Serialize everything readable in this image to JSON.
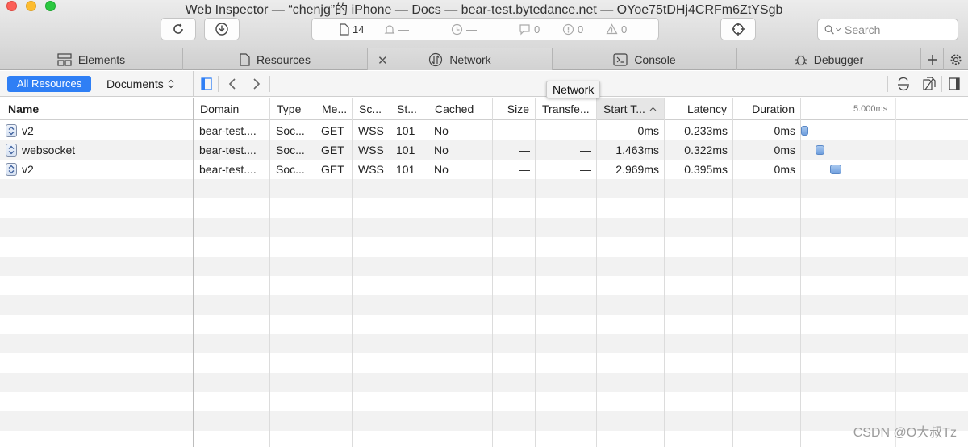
{
  "window": {
    "title": "Web Inspector — “chenjg”的 iPhone — Docs — bear-test.bytedance.net — OYoe75tDHj4CRFm6ZtYSgb"
  },
  "toolbar": {
    "resource_count": "14",
    "timeline_dash": "—",
    "timer_dash": "—",
    "log_count": "0",
    "error_count": "0",
    "warning_count": "0",
    "search_placeholder": "Search"
  },
  "tabs": [
    {
      "label": "Elements"
    },
    {
      "label": "Resources"
    },
    {
      "label": "Network"
    },
    {
      "label": "Console"
    },
    {
      "label": "Debugger"
    }
  ],
  "filters": {
    "all_resources": "All Resources",
    "documents": "Documents"
  },
  "tooltip": "Network",
  "left_pane": {
    "header": "Name"
  },
  "columns": {
    "domain": "Domain",
    "type": "Type",
    "method": "Me...",
    "scheme": "Sc...",
    "status": "St...",
    "cached": "Cached",
    "size": "Size",
    "transferred": "Transfe...",
    "start_time": "Start T...",
    "latency": "Latency",
    "duration": "Duration",
    "timeline_tick": "5.000ms"
  },
  "rows": [
    {
      "name": "v2",
      "domain": "bear-test....",
      "type": "Soc...",
      "method": "GET",
      "scheme": "WSS",
      "status": "101",
      "cached": "No",
      "size": "—",
      "transferred": "—",
      "start_time": "0ms",
      "latency": "0.233ms",
      "duration": "0ms",
      "start_ms": 0,
      "latency_ms": 0.233
    },
    {
      "name": "websocket",
      "domain": "bear-test....",
      "type": "Soc...",
      "method": "GET",
      "scheme": "WSS",
      "status": "101",
      "cached": "No",
      "size": "—",
      "transferred": "—",
      "start_time": "1.463ms",
      "latency": "0.322ms",
      "duration": "0ms",
      "start_ms": 1.463,
      "latency_ms": 0.322
    },
    {
      "name": "v2",
      "domain": "bear-test....",
      "type": "Soc...",
      "method": "GET",
      "scheme": "WSS",
      "status": "101",
      "cached": "No",
      "size": "—",
      "transferred": "—",
      "start_time": "2.969ms",
      "latency": "0.395ms",
      "duration": "0ms",
      "start_ms": 2.969,
      "latency_ms": 0.395
    }
  ],
  "watermark": "CSDN @O大叔Tz"
}
